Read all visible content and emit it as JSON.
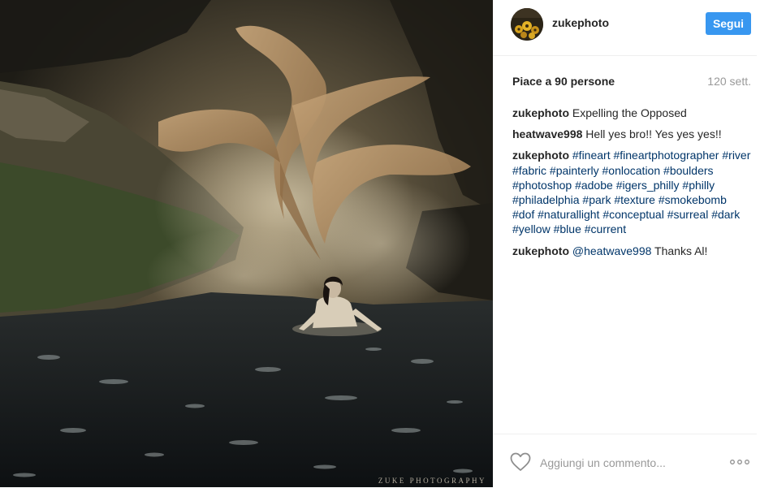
{
  "photo": {
    "watermark": "ZUKE PHOTOGRAPHY"
  },
  "post": {
    "username": "zukephoto",
    "follow_label": "Segui",
    "likes": "Piace a 90 persone",
    "age": "120 sett.",
    "comments": [
      {
        "user": "zukephoto",
        "text": "Expelling the Opposed"
      },
      {
        "user": "heatwave998",
        "text": "Hell yes bro!! Yes yes yes!!"
      },
      {
        "user": "zukephoto",
        "tags": [
          "#fineart",
          "#fineartphotographer",
          "#river",
          "#fabric",
          "#painterly",
          "#onlocation",
          "#boulders",
          "#photoshop",
          "#adobe",
          "#igers_philly",
          "#philly",
          "#philadelphia",
          "#park",
          "#texture",
          "#smokebomb",
          "#dof",
          "#naturallight",
          "#conceptual",
          "#surreal",
          "#dark",
          "#yellow",
          "#blue",
          "#current"
        ]
      },
      {
        "user": "zukephoto",
        "mention": "@heatwave998",
        "text": "Thanks Al!"
      }
    ],
    "comment_placeholder": "Aggiungi un commento..."
  },
  "icons": {
    "like": "heart-icon",
    "more": "more-options-icon"
  },
  "colors": {
    "follow_button": "#3897f0",
    "hashtag": "#003569",
    "muted_text": "#999999",
    "divider": "#efefef"
  }
}
